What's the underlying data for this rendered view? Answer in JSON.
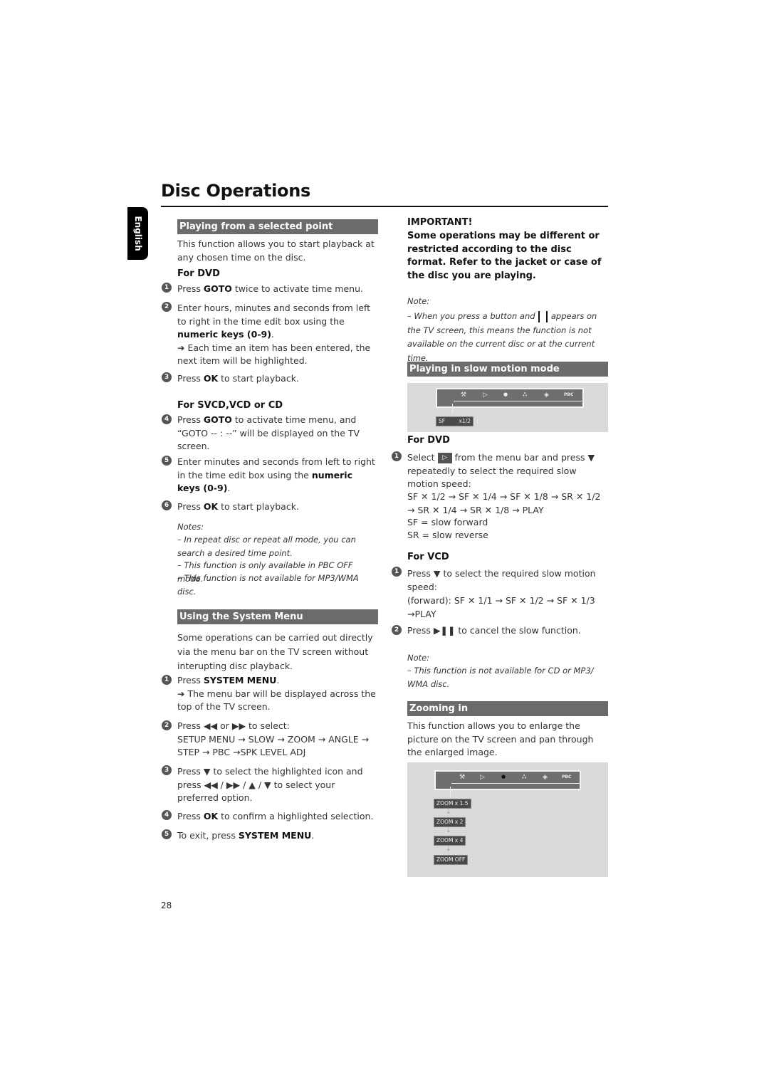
{
  "page": {
    "title": "Disc Operations",
    "language_tab": "English",
    "page_number": "28"
  },
  "left": {
    "sec1": {
      "heading": "Playing from a selected point",
      "intro": "This function allows you to start playback at any chosen time on the disc.",
      "dvd_heading": "For DVD",
      "dvd_steps": [
        {
          "num": "1",
          "pre": "Press ",
          "bold": "GOTO",
          "post": " twice to activate time menu."
        },
        {
          "num": "2",
          "pre": "Enter hours, minutes and seconds from left to right in the time edit box using the ",
          "bold": "numeric keys (0-9)",
          "post": ".",
          "result": "➔ Each time an item has been entered, the next item will be highlighted."
        },
        {
          "num": "3",
          "pre": "Press ",
          "bold": "OK",
          "post": " to start playback."
        }
      ],
      "svcd_heading": "For SVCD,VCD or CD",
      "svcd_steps": [
        {
          "num": "4",
          "pre": "Press ",
          "bold": "GOTO",
          "post": " to activate time menu,  and “GOTO -- : --” will be displayed on the TV screen."
        },
        {
          "num": "5",
          "pre": "Enter minutes and seconds from left to right in the time edit box using the ",
          "bold": "numeric keys (0-9)",
          "post": "."
        },
        {
          "num": "6",
          "pre": "Press ",
          "bold": "OK",
          "post": " to start playback."
        }
      ],
      "notes_label": "Notes:",
      "notes": [
        "–  In repeat disc or repeat all mode, you can search a desired time point.",
        "–  This function is only available in PBC OFF mode.",
        "–  This function is not available for MP3/WMA disc."
      ]
    },
    "sec2": {
      "heading": "Using the System Menu",
      "intro": "Some operations can be carried out directly via the menu bar on the TV screen without interupting disc playback.",
      "steps": [
        {
          "num": "1",
          "pre": "Press ",
          "bold": "SYSTEM MENU",
          "post": ".",
          "result": "➔ The menu bar will be displayed across the top of the TV screen."
        },
        {
          "num": "2",
          "text": "Press ◀◀ or ▶▶ to select:",
          "sequence": "SETUP MENU → SLOW → ZOOM → ANGLE → STEP → PBC →SPK LEVEL ADJ"
        },
        {
          "num": "3",
          "text": "Press ▼ to select the highlighted icon and press ◀◀ / ▶▶  /  ▲ / ▼ to select your preferred option."
        },
        {
          "num": "4",
          "pre": "Press ",
          "bold": "OK",
          "post": " to confirm a highlighted selection."
        },
        {
          "num": "5",
          "pre": "To exit, press ",
          "bold": "SYSTEM MENU",
          "post": "."
        }
      ]
    }
  },
  "right": {
    "important_label": "IMPORTANT!",
    "important_text": "Some operations may be different or restricted according to the disc format. Refer to the jacket or case of the disc you are playing.",
    "note_label": "Note:",
    "note_pre": "–  When you press a button and ",
    "note_post": " appears on the TV screen, this means the function is not available on the current disc or at the current time.",
    "slow": {
      "heading": "Playing in slow motion mode",
      "figure": {
        "menu_icons": [
          "setup-icon",
          "slow-icon",
          "zoom-icon",
          "angle-icon",
          "step-icon",
          "pbc-icon"
        ],
        "menu_icon_glyphs": [
          "⚒",
          "▷",
          "●",
          "∴",
          "◈",
          "PBC"
        ],
        "status_label": "SF",
        "status_value": "x1/2"
      },
      "dvd_heading": "For DVD",
      "dvd_step": {
        "num": "1",
        "pre": "Select ",
        "icon": "▷",
        "post": " from the menu bar and press ▼ repeatedly to select the required slow motion speed:"
      },
      "dvd_sequence": "SF ✕ 1/2 → SF ✕ 1/4 → SF ✕ 1/8 → SR ✕ 1/2 → SR ✕ 1/4 → SR ✕ 1/8 → PLAY",
      "sf_def": "SF = slow forward",
      "sr_def": "SR = slow reverse",
      "vcd_heading": "For VCD",
      "vcd_steps": [
        {
          "num": "1",
          "text": "Press ▼ to select the required slow motion speed:",
          "sequence": "(forward): SF ✕ 1/1 → SF ✕ 1/2 → SF ✕ 1/3 →PLAY"
        },
        {
          "num": "2",
          "text": "Press ▶❚❚ to cancel  the slow function."
        }
      ],
      "note_label": "Note:",
      "note": "–  This function is not available for CD or MP3/ WMA disc."
    },
    "zoom": {
      "heading": "Zooming in",
      "intro": "This function allows you to enlarge the picture on the TV screen and pan through the enlarged image.",
      "figure": {
        "menu_icon_glyphs": [
          "⚒",
          "▷",
          "●",
          "∴",
          "◈",
          "PBC"
        ],
        "levels": [
          "ZOOM  x 1.5",
          "ZOOM  x 2",
          "ZOOM  x 4",
          "ZOOM  OFF"
        ],
        "arrow": "⇣"
      }
    }
  }
}
